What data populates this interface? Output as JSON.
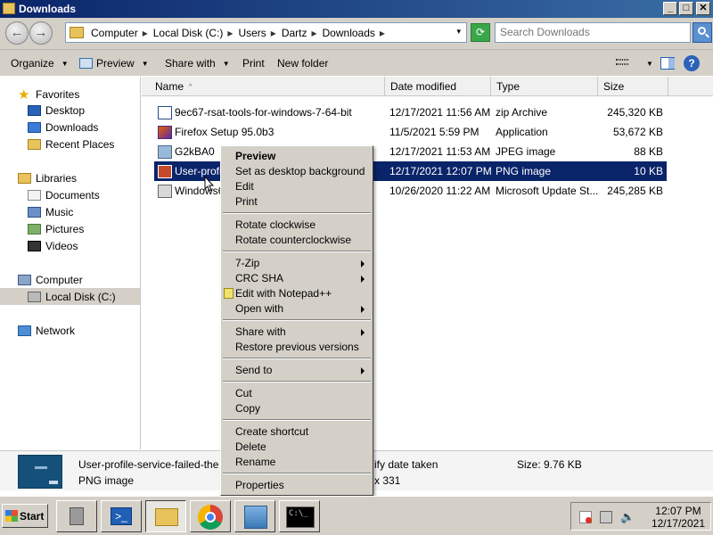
{
  "window": {
    "title": "Downloads"
  },
  "titlebar_buttons": {
    "minimize": "_",
    "maximize": "□",
    "close": "✕"
  },
  "address": {
    "crumbs": [
      "Computer",
      "Local Disk (C:)",
      "Users",
      "Dartz",
      "Downloads"
    ],
    "separator": "▸",
    "dropdown": "▾"
  },
  "search": {
    "placeholder": "Search Downloads"
  },
  "toolbar": {
    "organize": "Organize",
    "preview": "Preview",
    "share_with": "Share with",
    "print": "Print",
    "new_folder": "New folder",
    "caret": "▼",
    "help": "?"
  },
  "nav": {
    "favorites": "Favorites",
    "desktop": "Desktop",
    "downloads": "Downloads",
    "recent_places": "Recent Places",
    "libraries": "Libraries",
    "documents": "Documents",
    "music": "Music",
    "pictures": "Pictures",
    "videos": "Videos",
    "computer": "Computer",
    "local_disk": "Local Disk (C:)",
    "network": "Network"
  },
  "columns": {
    "name": "Name",
    "date": "Date modified",
    "type": "Type",
    "size": "Size",
    "sort_icon": "^"
  },
  "files": [
    {
      "name": "9ec67-rsat-tools-for-windows-7-64-bit",
      "date": "12/17/2021 11:56 AM",
      "type": "zip Archive",
      "size": "245,320 KB",
      "icon": "zip-icon"
    },
    {
      "name": "Firefox Setup 95.0b3",
      "date": "11/5/2021 5:59 PM",
      "type": "Application",
      "size": "53,672 KB",
      "icon": "firefox-installer-icon"
    },
    {
      "name": "G2kBA0",
      "date": "12/17/2021 11:53 AM",
      "type": "JPEG image",
      "size": "88 KB",
      "icon": "jpeg-icon"
    },
    {
      "name": "User-profi",
      "date": "12/17/2021 12:07 PM",
      "type": "PNG image",
      "size": "10 KB",
      "icon": "png-icon"
    },
    {
      "name": "Windows6",
      "date": "10/26/2020 11:22 AM",
      "type": "Microsoft Update St...",
      "size": "245,285 KB",
      "icon": "msu-icon"
    }
  ],
  "context_menu": {
    "preview": "Preview",
    "set_bg": "Set as desktop background",
    "edit": "Edit",
    "print": "Print",
    "rotate_cw": "Rotate clockwise",
    "rotate_ccw": "Rotate counterclockwise",
    "sevenzip": "7-Zip",
    "crc_sha": "CRC SHA",
    "edit_npp": "Edit with Notepad++",
    "open_with": "Open with",
    "share_with": "Share with",
    "restore": "Restore previous versions",
    "send_to": "Send to",
    "cut": "Cut",
    "copy": "Copy",
    "create_shortcut": "Create shortcut",
    "delete": "Delete",
    "rename": "Rename",
    "properties": "Properties"
  },
  "details": {
    "filename": "User-profile-service-failed-the",
    "filetype": "PNG image",
    "date_taken": "ify date taken",
    "dimensions": "x 331",
    "size": "Size: 9.76 KB"
  },
  "taskbar": {
    "start": "Start",
    "cmd_label": "C:\\_",
    "time": "12:07 PM",
    "date": "12/17/2021"
  },
  "colors": {
    "selection": "#0a246a",
    "titlebar": "#0a246a",
    "chrome": "#d4d0c8"
  }
}
